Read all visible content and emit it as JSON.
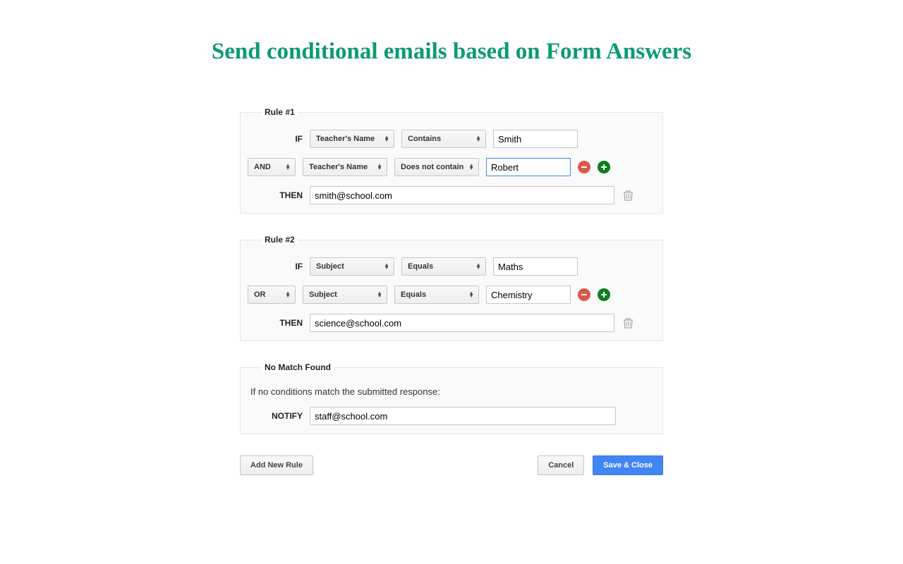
{
  "title": "Send conditional emails based on Form Answers",
  "labels": {
    "if": "IF",
    "then": "THEN",
    "notify": "NOTIFY"
  },
  "rules": [
    {
      "legend": "Rule #1",
      "conditions": [
        {
          "logic": "",
          "field": "Teacher's Name",
          "op": "Contains",
          "value": "Smith",
          "focused": false,
          "showActions": false
        },
        {
          "logic": "AND",
          "field": "Teacher's Name",
          "op": "Does not contain",
          "value": "Robert",
          "focused": true,
          "showActions": true
        }
      ],
      "then": "smith@school.com"
    },
    {
      "legend": "Rule #2",
      "conditions": [
        {
          "logic": "",
          "field": "Subject",
          "op": "Equals",
          "value": "Maths",
          "focused": false,
          "showActions": false
        },
        {
          "logic": "OR",
          "field": "Subject",
          "op": "Equals",
          "value": "Chemistry",
          "focused": false,
          "showActions": true
        }
      ],
      "then": "science@school.com"
    }
  ],
  "noMatch": {
    "legend": "No Match Found",
    "description": "If no conditions match the submitted response:",
    "notify": "staff@school.com"
  },
  "buttons": {
    "addRule": "Add New Rule",
    "cancel": "Cancel",
    "save": "Save & Close"
  }
}
